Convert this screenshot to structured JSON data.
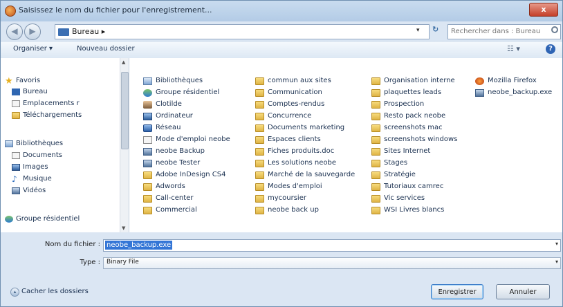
{
  "window": {
    "title": "Saisissez le nom du fichier pour l'enregistrement...",
    "close_label": "x"
  },
  "addressbar": {
    "back_icon": "arrow-left-icon",
    "forward_icon": "arrow-right-icon",
    "crumb": "Bureau ▸",
    "dropdown": "▾",
    "refresh": "↻",
    "search_placeholder": "Rechercher dans : Bureau"
  },
  "toolbar": {
    "organize_label": "Organiser ▾",
    "new_folder_label": "Nouveau dossier",
    "view_label": "☷ ▾",
    "help_label": "?"
  },
  "sidebar": {
    "items": [
      {
        "label": "Favoris",
        "icon": "star-icon"
      },
      {
        "label": "Bureau",
        "icon": "desktop-icon"
      },
      {
        "label": "Emplacements r",
        "icon": "recent-places-icon"
      },
      {
        "label": "Téléchargements",
        "icon": "downloads-folder-icon"
      },
      {
        "label": "Bibliothèques",
        "icon": "library-icon"
      },
      {
        "label": "Documents",
        "icon": "documents-icon"
      },
      {
        "label": "Images",
        "icon": "images-icon"
      },
      {
        "label": "Musique",
        "icon": "music-icon"
      },
      {
        "label": "Vidéos",
        "icon": "videos-icon"
      },
      {
        "label": "Groupe résidentiel",
        "icon": "homegroup-icon"
      }
    ]
  },
  "files": {
    "col1": [
      {
        "label": "Bibliothèques",
        "icon": "library-icon"
      },
      {
        "label": "Groupe résidentiel",
        "icon": "homegroup-icon"
      },
      {
        "label": "Clotilde",
        "icon": "user-folder-icon"
      },
      {
        "label": "Ordinateur",
        "icon": "computer-icon"
      },
      {
        "label": "Réseau",
        "icon": "network-icon"
      },
      {
        "label": "Mode d'emploi neobe",
        "icon": "document-icon"
      },
      {
        "label": "neobe Backup",
        "icon": "shortcut-icon"
      },
      {
        "label": "neobe Tester",
        "icon": "shortcut-icon"
      },
      {
        "label": "Adobe InDesign CS4",
        "icon": "folder-icon"
      },
      {
        "label": "Adwords",
        "icon": "folder-icon"
      },
      {
        "label": "Call-center",
        "icon": "folder-icon"
      },
      {
        "label": "Commercial",
        "icon": "folder-icon"
      }
    ],
    "col2": [
      {
        "label": "commun aux sites",
        "icon": "folder-icon"
      },
      {
        "label": "Communication",
        "icon": "folder-icon"
      },
      {
        "label": "Comptes-rendus",
        "icon": "folder-icon"
      },
      {
        "label": "Concurrence",
        "icon": "folder-icon"
      },
      {
        "label": "Documents marketing",
        "icon": "folder-icon"
      },
      {
        "label": "Espaces clients",
        "icon": "folder-icon"
      },
      {
        "label": "Fiches produits.doc",
        "icon": "folder-icon"
      },
      {
        "label": "Les solutions neobe",
        "icon": "folder-icon"
      },
      {
        "label": "Marché de la sauvegarde",
        "icon": "folder-icon"
      },
      {
        "label": "Modes d'emploi",
        "icon": "folder-icon"
      },
      {
        "label": "mycoursier",
        "icon": "folder-icon"
      },
      {
        "label": "neobe back up",
        "icon": "folder-icon"
      }
    ],
    "col3": [
      {
        "label": "Organisation interne",
        "icon": "folder-icon"
      },
      {
        "label": "plaquettes leads",
        "icon": "folder-icon"
      },
      {
        "label": "Prospection",
        "icon": "folder-icon"
      },
      {
        "label": "Resto pack neobe",
        "icon": "folder-icon"
      },
      {
        "label": "screenshots mac",
        "icon": "folder-icon"
      },
      {
        "label": "screenshots windows",
        "icon": "folder-icon"
      },
      {
        "label": "Sites Internet",
        "icon": "folder-icon"
      },
      {
        "label": "Stages",
        "icon": "folder-icon"
      },
      {
        "label": "Stratégie",
        "icon": "folder-icon"
      },
      {
        "label": "Tutoriaux camrec",
        "icon": "folder-icon"
      },
      {
        "label": "Vic services",
        "icon": "folder-icon"
      },
      {
        "label": "WSI Livres blancs",
        "icon": "folder-icon"
      }
    ],
    "col4": [
      {
        "label": "Mozilla Firefox",
        "icon": "firefox-icon"
      },
      {
        "label": "neobe_backup.exe",
        "icon": "exe-icon"
      }
    ]
  },
  "form": {
    "filename_label": "Nom du fichier :",
    "filename_value": "neobe_backup.exe",
    "type_label": "Type :",
    "type_value": "Binary File",
    "dropdown": "▾"
  },
  "footer": {
    "hide_folders_label": "Cacher les dossiers",
    "hide_folders_icon": "▴",
    "save_label": "Enregistrer",
    "cancel_label": "Annuler"
  }
}
